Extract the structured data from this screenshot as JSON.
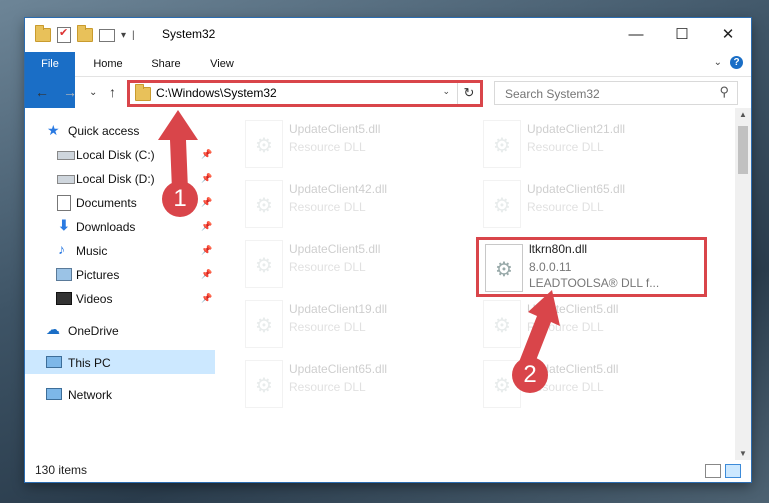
{
  "window": {
    "title": "System32",
    "controls": {
      "minimize": "—",
      "maximize": "☐",
      "close": "✕"
    }
  },
  "ribbon": {
    "tabs": [
      "File",
      "Home",
      "Share",
      "View"
    ],
    "collapse_glyph": "⌄",
    "help_glyph": "?"
  },
  "nav": {
    "back": "←",
    "forward": "→",
    "recent": "⌄",
    "up": "↑"
  },
  "address": {
    "path": "C:\\Windows\\System32",
    "dropdown": "⌄",
    "refresh": "↻"
  },
  "search": {
    "placeholder": "Search System32",
    "icon": "search-icon"
  },
  "sidebar": {
    "items": [
      {
        "label": "Quick access",
        "icon": "star-icon"
      },
      {
        "label": "Local Disk (C:)",
        "icon": "drive-icon",
        "pinned": true
      },
      {
        "label": "Local Disk (D:)",
        "icon": "drive-icon",
        "pinned": true
      },
      {
        "label": "Documents",
        "icon": "documents-icon",
        "pinned": true
      },
      {
        "label": "Downloads",
        "icon": "download-icon",
        "pinned": true
      },
      {
        "label": "Music",
        "icon": "music-icon",
        "pinned": true
      },
      {
        "label": "Pictures",
        "icon": "pictures-icon",
        "pinned": true
      },
      {
        "label": "Videos",
        "icon": "videos-icon",
        "pinned": true
      },
      {
        "label": "OneDrive",
        "icon": "cloud-icon"
      },
      {
        "label": "This PC",
        "icon": "computer-icon",
        "selected": true
      },
      {
        "label": "Network",
        "icon": "network-icon"
      }
    ]
  },
  "files": [
    {
      "name": "UpdateClient5.dll",
      "desc": "Resource DLL"
    },
    {
      "name": "UpdateClient21.dll",
      "desc": "Resource DLL"
    },
    {
      "name": "UpdateClient42.dll",
      "desc": "Resource DLL"
    },
    {
      "name": "UpdateClient65.dll",
      "desc": "Resource DLL"
    },
    {
      "name": "UpdateClient5.dll",
      "desc": "Resource DLL"
    },
    {
      "name": "ltkrn80n.dll",
      "version": "8.0.0.11",
      "desc": "LEADTOOLSA® DLL f..."
    },
    {
      "name": "UpdateClient19.dll",
      "desc": "Resource DLL"
    },
    {
      "name": "UpdateClient5.dll",
      "desc": "Resource DLL"
    },
    {
      "name": "UpdateClient65.dll",
      "desc": "Resource DLL"
    },
    {
      "name": "UpdateClient5.dll",
      "desc": "Resource DLL"
    }
  ],
  "status": {
    "item_count": "130 items"
  },
  "annotations": {
    "step1": "1",
    "step2": "2",
    "color": "#d9454a"
  }
}
